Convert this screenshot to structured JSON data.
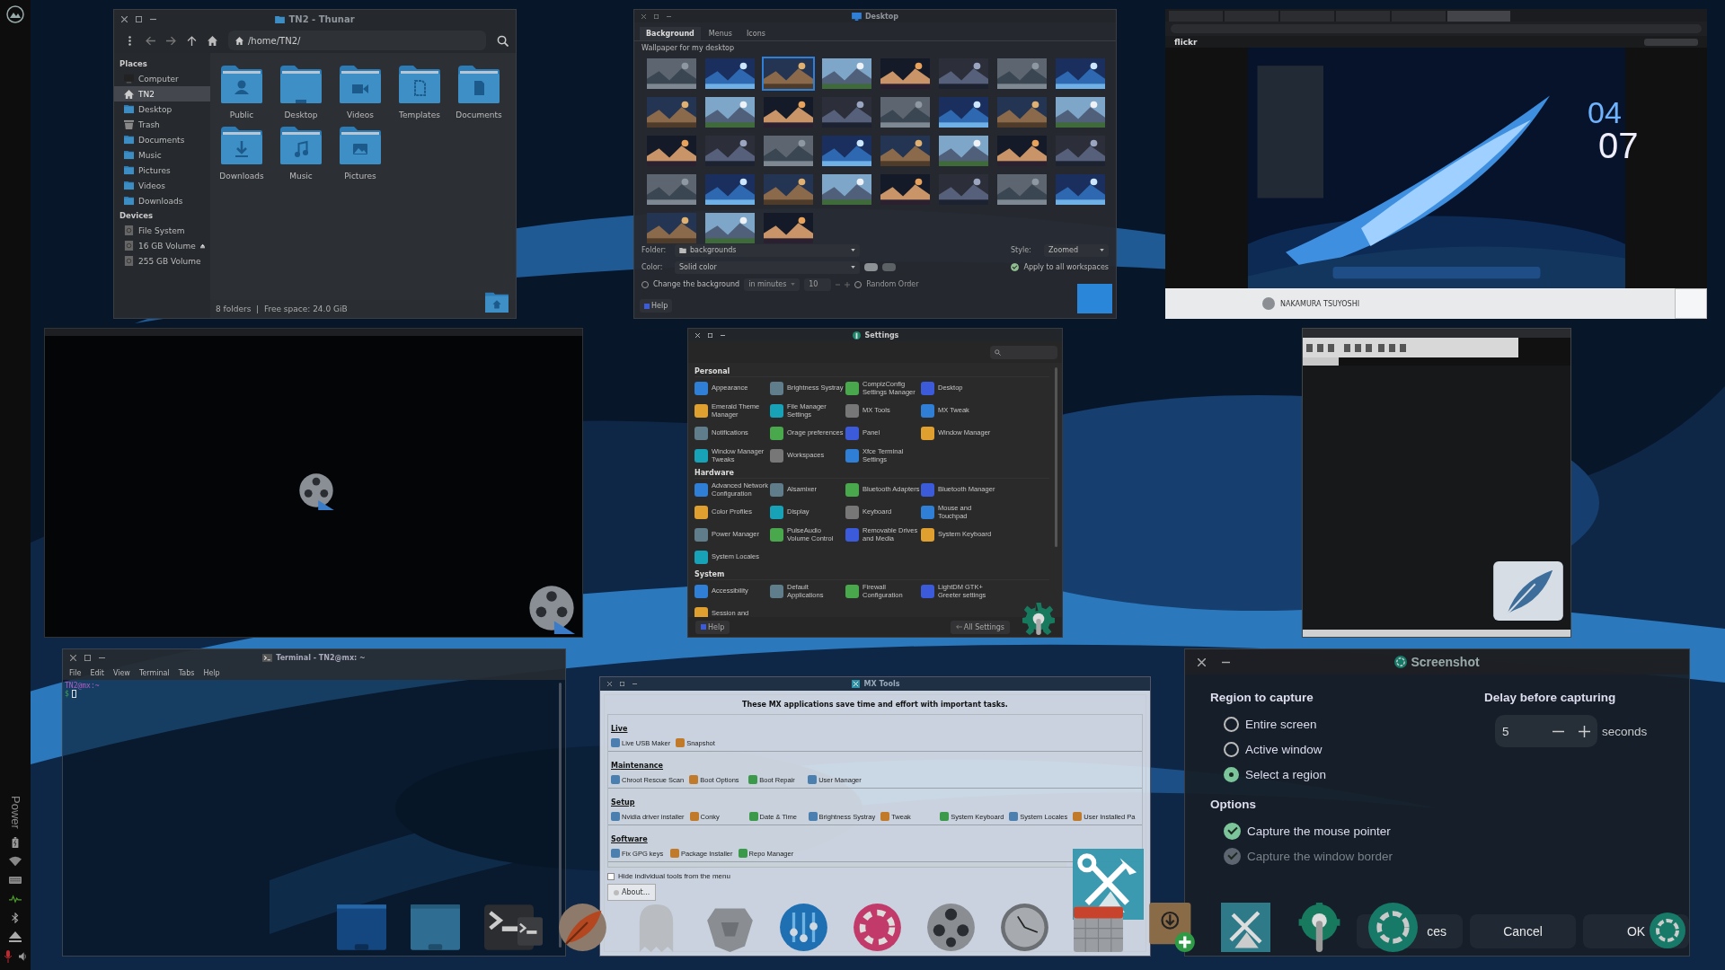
{
  "side_panel": {
    "vertical_label": "Power"
  },
  "thunar": {
    "title": "TN2 - Thunar",
    "location": "/home/TN2/",
    "sections": [
      {
        "heading": "Places",
        "items": [
          {
            "label": "Computer",
            "kind": "computer",
            "selected": false
          },
          {
            "label": "TN2",
            "kind": "home",
            "selected": true
          },
          {
            "label": "Desktop",
            "kind": "folder",
            "selected": false
          },
          {
            "label": "Trash",
            "kind": "trash",
            "selected": false
          },
          {
            "label": "Documents",
            "kind": "folder",
            "selected": false
          },
          {
            "label": "Music",
            "kind": "folder",
            "selected": false
          },
          {
            "label": "Pictures",
            "kind": "folder",
            "selected": false
          },
          {
            "label": "Videos",
            "kind": "folder",
            "selected": false
          },
          {
            "label": "Downloads",
            "kind": "folder",
            "selected": false
          }
        ]
      },
      {
        "heading": "Devices",
        "items": [
          {
            "label": "File System",
            "kind": "drive",
            "selected": false
          },
          {
            "label": "16 GB Volume",
            "kind": "removable",
            "selected": false
          },
          {
            "label": "255 GB Volume",
            "kind": "drive",
            "selected": false
          }
        ]
      }
    ],
    "folders": [
      {
        "label": "Public",
        "kind": "person"
      },
      {
        "label": "Desktop",
        "kind": "blank"
      },
      {
        "label": "Videos",
        "kind": "video"
      },
      {
        "label": "Templates",
        "kind": "template"
      },
      {
        "label": "Documents",
        "kind": "document"
      },
      {
        "label": "Downloads",
        "kind": "download"
      },
      {
        "label": "Music",
        "kind": "music"
      },
      {
        "label": "Pictures",
        "kind": "picture"
      }
    ],
    "status": "8 folders  |  Free space: 24.0 GiB"
  },
  "desktop_settings": {
    "title": "Desktop",
    "tabs": [
      {
        "label": "Background",
        "selected": true
      },
      {
        "label": "Menus",
        "selected": false
      },
      {
        "label": "Icons",
        "selected": false
      }
    ],
    "section_label": "Wallpaper for my desktop",
    "wallpapers": [
      {
        "selected": false
      },
      {
        "selected": false
      },
      {
        "selected": true
      },
      {
        "selected": false
      },
      {
        "selected": false
      },
      {
        "selected": false
      },
      {
        "selected": false
      },
      {
        "selected": false
      },
      {
        "selected": false
      },
      {
        "selected": false
      },
      {
        "selected": false
      },
      {
        "selected": false
      },
      {
        "selected": false
      },
      {
        "selected": false
      },
      {
        "selected": false
      },
      {
        "selected": false
      },
      {
        "selected": false
      },
      {
        "selected": false
      },
      {
        "selected": false
      },
      {
        "selected": false
      },
      {
        "selected": false
      },
      {
        "selected": false
      },
      {
        "selected": false
      },
      {
        "selected": false
      },
      {
        "selected": false
      },
      {
        "selected": false
      },
      {
        "selected": false
      },
      {
        "selected": false
      },
      {
        "selected": false
      },
      {
        "selected": false
      },
      {
        "selected": false
      },
      {
        "selected": false
      },
      {
        "selected": false
      },
      {
        "selected": false
      },
      {
        "selected": false
      }
    ],
    "folder_label": "Folder:",
    "folder": "backgrounds",
    "style_label": "Style:",
    "style": "Zoomed",
    "color_label": "Color:",
    "color_mode": "Solid color",
    "apply_all": {
      "label": "Apply to all workspaces",
      "checked": true
    },
    "change_background": {
      "label": "Change the background",
      "checked": false
    },
    "interval_unit": "in minutes",
    "interval": "10",
    "random_order": {
      "label": "Random Order",
      "checked": false
    },
    "help": "Help"
  },
  "browser": {
    "brand": "flickr",
    "clock_hours": "04",
    "clock_minutes": "07",
    "author": "NAKAMURA TSUYOSHI"
  },
  "settings": {
    "title": "Settings",
    "sections": [
      {
        "heading": "Personal",
        "items": [
          "Appearance",
          "Brightness Systray",
          "CompizConfig Settings Manager",
          "Desktop",
          "Emerald Theme Manager",
          "File Manager Settings",
          "MX Tools",
          "MX Tweak",
          "Notifications",
          "Orage preferences",
          "Panel",
          "Window Manager",
          "Window Manager Tweaks",
          "Workspaces",
          "Xfce Terminal Settings"
        ]
      },
      {
        "heading": "Hardware",
        "items": [
          "Advanced Network Configuration",
          "Alsamixer",
          "Bluetooth Adapters",
          "Bluetooth Manager",
          "Color Profiles",
          "Display",
          "Keyboard",
          "Mouse and Touchpad",
          "Power Manager",
          "PulseAudio Volume Control",
          "Removable Drives and Media",
          "System Keyboard",
          "System Locales"
        ]
      },
      {
        "heading": "System",
        "items": [
          "Accessibility",
          "Default Applications",
          "Firewall Configuration",
          "LightDM GTK+ Greeter settings",
          "Session and"
        ]
      }
    ],
    "help": "Help",
    "all_settings": "All Settings"
  },
  "terminal": {
    "title": "Terminal - TN2@mx: ~",
    "menu": [
      "File",
      "Edit",
      "View",
      "Terminal",
      "Tabs",
      "Help"
    ],
    "prompt": "TN2@mx:~",
    "input_prompt": "$"
  },
  "mx_tools": {
    "title": "MX Tools",
    "intro": "These MX applications save time and effort with important tasks.",
    "groups": [
      {
        "heading": "Live",
        "tools": [
          "Live USB Maker",
          "Snapshot"
        ]
      },
      {
        "heading": "Maintenance",
        "tools": [
          "Chroot Rescue Scan",
          "Boot Options",
          "Boot Repair",
          "User Manager"
        ]
      },
      {
        "heading": "Setup",
        "tools": [
          "Nvidia driver installer",
          "Conky",
          "Date & Time",
          "Brightness Systray",
          "Tweak",
          "System Keyboard",
          "System Locales",
          "User Installed Pa"
        ]
      },
      {
        "heading": "Software",
        "tools": [
          "Fix GPG keys",
          "Package Installer",
          "Repo Manager"
        ]
      }
    ],
    "hide_tools": {
      "label": "Hide individual tools from the menu",
      "checked": false
    },
    "about": "About..."
  },
  "screenshot": {
    "title": "Screenshot",
    "region_heading": "Region to capture",
    "regions": [
      {
        "label": "Entire screen",
        "selected": false
      },
      {
        "label": "Active window",
        "selected": false
      },
      {
        "label": "Select a region",
        "selected": true
      }
    ],
    "delay_heading": "Delay before capturing",
    "delay": "5",
    "delay_unit": "seconds",
    "options_heading": "Options",
    "options": [
      {
        "label": "Capture the mouse pointer",
        "checked": true,
        "disabled": false
      },
      {
        "label": "Capture the window border",
        "checked": true,
        "disabled": true
      }
    ],
    "buttons": [
      "ces",
      "Cancel",
      "OK"
    ]
  }
}
